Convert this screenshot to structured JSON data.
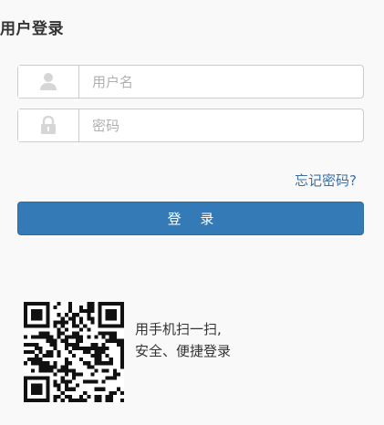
{
  "title": "用户登录",
  "username": {
    "placeholder": "用户名",
    "icon": "user-icon"
  },
  "password": {
    "placeholder": "密码",
    "icon": "lock-icon"
  },
  "forgot_password": "忘记密码?",
  "login_button": "登 录",
  "qr": {
    "icon": "qr-code",
    "line1": "用手机扫一扫,",
    "line2": "安全、便捷登录"
  },
  "colors": {
    "primary": "#337ab7",
    "link": "#3d6fa4",
    "border": "#cccccc",
    "background": "#f9f9f9"
  }
}
